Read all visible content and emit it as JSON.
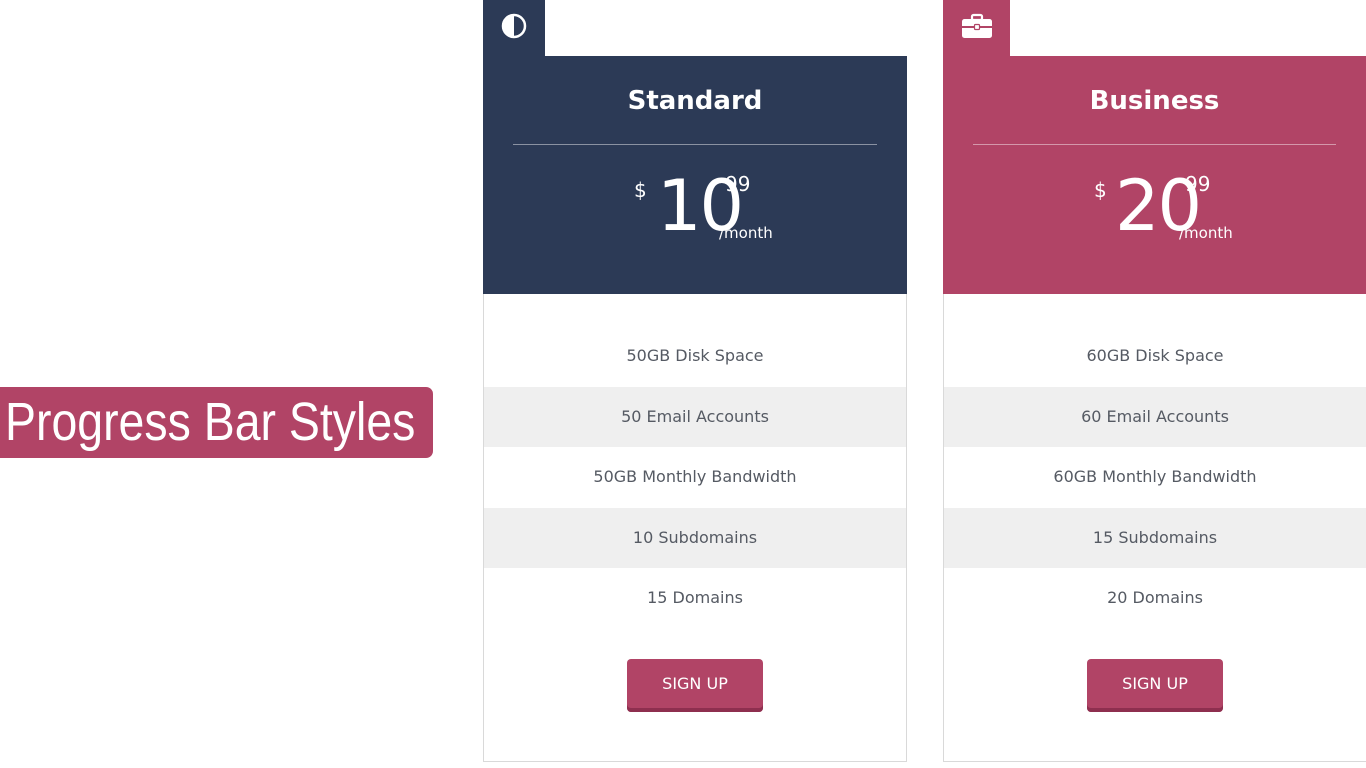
{
  "badge": {
    "label": "Progress Bar Styles"
  },
  "colors": {
    "standard_header": "#2c3a56",
    "business_header": "#b14466",
    "button": "#b14466",
    "feature_alt_row": "#efefef",
    "feature_text": "#555a63"
  },
  "plans": [
    {
      "name": "Standard",
      "icon": "half-circle-contrast-icon",
      "currency": "$",
      "amount": "10",
      "cents": "99",
      "period": "/month",
      "features": [
        "50GB Disk Space",
        "50 Email Accounts",
        "50GB Monthly Bandwidth",
        "10 Subdomains",
        "15 Domains"
      ],
      "button_label": "SIGN UP"
    },
    {
      "name": "Business",
      "icon": "briefcase-icon",
      "currency": "$",
      "amount": "20",
      "cents": "99",
      "period": "/month",
      "features": [
        "60GB Disk Space",
        "60 Email Accounts",
        "60GB Monthly Bandwidth",
        "15 Subdomains",
        "20 Domains"
      ],
      "button_label": "SIGN UP"
    }
  ]
}
